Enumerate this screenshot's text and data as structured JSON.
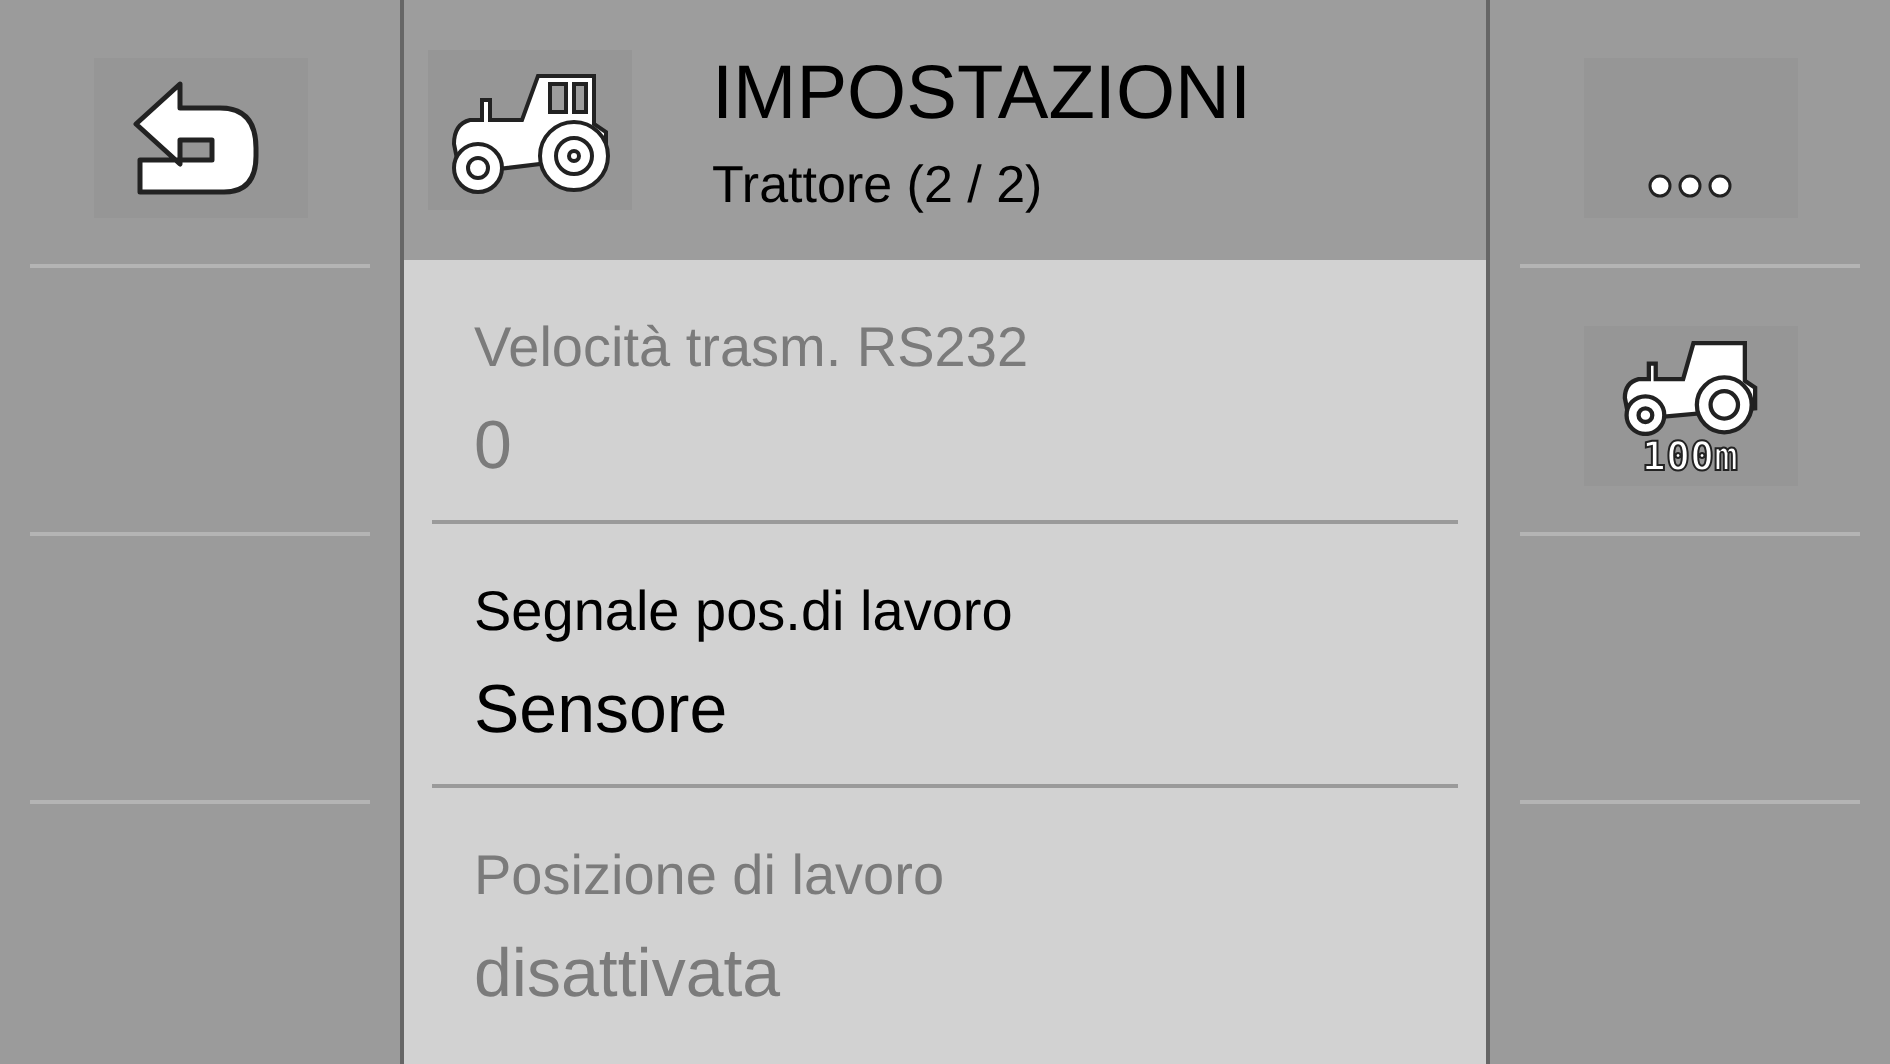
{
  "header": {
    "title": "IMPOSTAZIONI",
    "subtitle": "Trattore (2 / 2)"
  },
  "left_keys": [
    {
      "kind": "back"
    },
    {
      "kind": "empty"
    },
    {
      "kind": "empty"
    },
    {
      "kind": "empty"
    }
  ],
  "right_keys": [
    {
      "kind": "more"
    },
    {
      "kind": "tractor",
      "caption": "100m"
    },
    {
      "kind": "empty"
    },
    {
      "kind": "empty"
    }
  ],
  "settings": [
    {
      "label": "Velocità trasm. RS232",
      "value": "0",
      "disabled": true
    },
    {
      "label": "Segnale pos.di lavoro",
      "value": "Sensore",
      "disabled": false
    },
    {
      "label": "Posizione di lavoro",
      "value": "disattivata",
      "disabled": true
    }
  ]
}
